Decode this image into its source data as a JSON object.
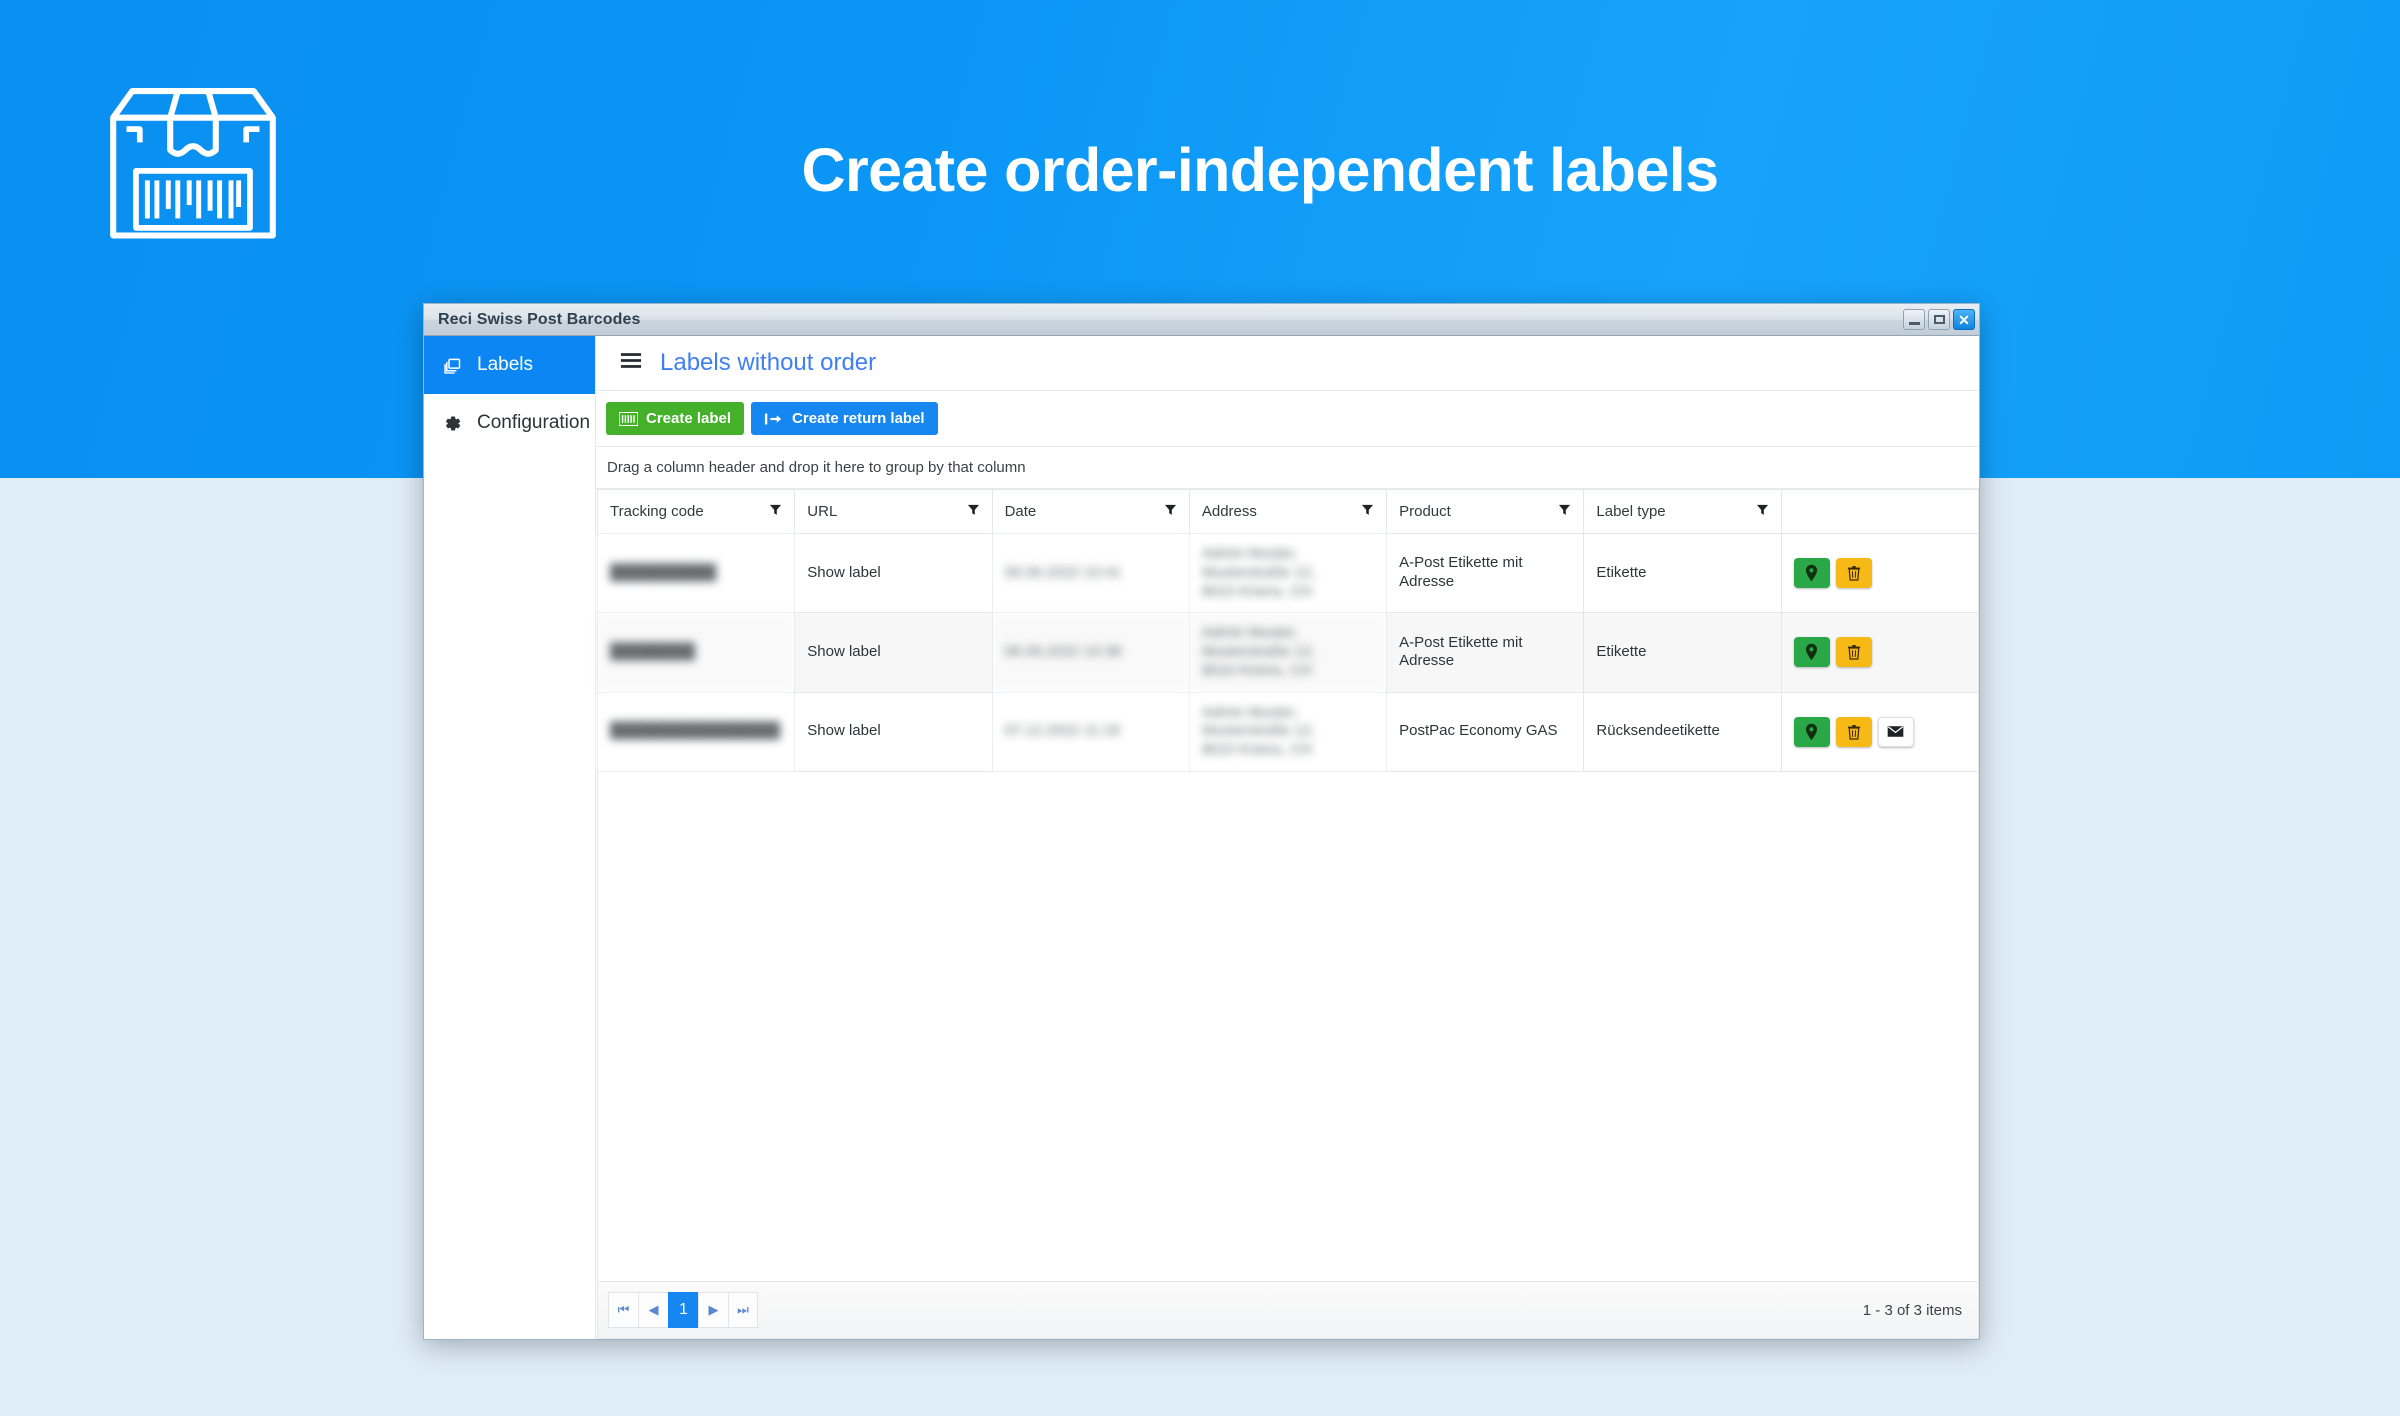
{
  "promo": {
    "title": "Create order-independent labels",
    "logo_icon": "parcel-box-barcode-icon",
    "banner_color": "#0b96f5",
    "backdrop_color": "#dfedf9"
  },
  "window": {
    "title": "Reci Swiss Post Barcodes",
    "controls": {
      "minimize_icon": "minimize-icon",
      "maximize_icon": "maximize-icon",
      "close_label": "✕"
    }
  },
  "sidebar": {
    "items": [
      {
        "label": "Labels",
        "icon": "labels-stack-icon",
        "active": true
      },
      {
        "label": "Configuration",
        "icon": "gear-icon",
        "active": false
      }
    ]
  },
  "content": {
    "menu_icon": "hamburger-menu-icon",
    "title": "Labels without order",
    "title_color": "#3f7ff2"
  },
  "toolbar": {
    "create_label": {
      "label": "Create label",
      "icon": "barcode-icon",
      "color": "#45b02a"
    },
    "create_return_label": {
      "label": "Create return label",
      "icon": "return-arrow-icon",
      "color": "#1686f0"
    }
  },
  "group_bar": {
    "hint": "Drag a column header and drop it here to group by that column"
  },
  "grid": {
    "columns": [
      {
        "label": "Tracking code",
        "filter_icon": "filter-icon"
      },
      {
        "label": "URL",
        "filter_icon": "filter-icon"
      },
      {
        "label": "Date",
        "filter_icon": "filter-icon"
      },
      {
        "label": "Address",
        "filter_icon": "filter-icon"
      },
      {
        "label": "Product",
        "filter_icon": "filter-icon"
      },
      {
        "label": "Label type",
        "filter_icon": "filter-icon"
      },
      {
        "label": "",
        "filter_icon": ""
      }
    ],
    "rows": [
      {
        "tracking_code": "██████████",
        "tracking_redacted": true,
        "url": "Show label",
        "date": "06.06.2022 10:41",
        "date_redacted": true,
        "address_lines": [
          "Admin Muster,",
          "Musterstraße 12,",
          "8010 Kriens, CH"
        ],
        "address_redacted": true,
        "product": "A-Post Etikette mit Adresse",
        "label_type": "Etikette",
        "actions": [
          "track-pin-button",
          "delete-button"
        ]
      },
      {
        "tracking_code": "████████",
        "tracking_redacted": true,
        "url": "Show label",
        "date": "06.06.2022 10:38",
        "date_redacted": true,
        "address_lines": [
          "Admin Muster,",
          "Musterstraße 12,",
          "8010 Kriens, CH"
        ],
        "address_redacted": true,
        "product": "A-Post Etikette mit Adresse",
        "label_type": "Etikette",
        "actions": [
          "track-pin-button",
          "delete-button"
        ]
      },
      {
        "tracking_code": "████████████████",
        "tracking_redacted": true,
        "url": "Show label",
        "date": "07.12.2022 11:16",
        "date_redacted": true,
        "address_lines": [
          "Admin Muster,",
          "Musterstraße 12,",
          "8010 Kriens, CH"
        ],
        "address_redacted": true,
        "product": "PostPac Economy GAS",
        "label_type": "Rücksendeetikette",
        "actions": [
          "track-pin-button",
          "delete-button",
          "email-button"
        ]
      }
    ]
  },
  "pager": {
    "first_label": "⏮",
    "prev_label": "◀",
    "current_page": "1",
    "next_label": "▶",
    "last_label": "⏭",
    "info": "1 - 3 of 3 items"
  }
}
